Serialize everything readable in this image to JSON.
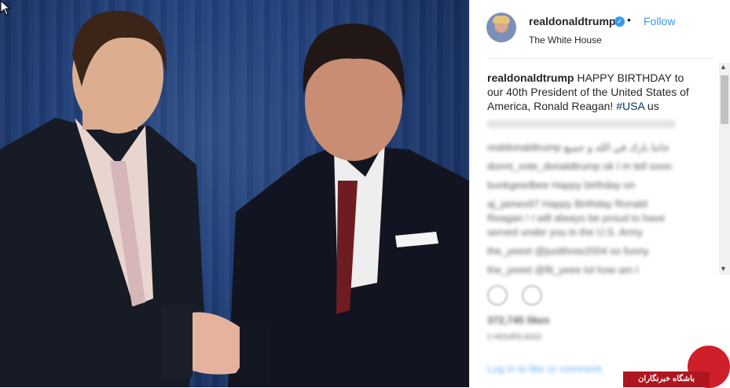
{
  "post": {
    "username": "realdonaldtrump",
    "follow_label": "Follow",
    "separator": "•",
    "location": "The White House",
    "caption_text": "HAPPY BIRTHDAY to our 40th President of the United States of America, Ronald Reagan!",
    "hashtag": "#USA",
    "caption_tail": "us"
  },
  "blurred_comments": [
    "realdonaldtrump خاتنا بارك في الله و جميع",
    "donnt_vote_donaldtrump ok I m tell soon",
    "bunkgeedbee Happy birthday on",
    "aj_james97 Happy Birthday Ronald",
    "Reagan ! I will always be proud to have",
    "served under you in the U.S. Army",
    "the_yeeet @justthree2004 so funny",
    "the_yeeet @fit_yeee lol how am I"
  ],
  "blurred_stats": {
    "likes": "372,745 likes",
    "time": "2 HOURS AGO",
    "login": "Log in to like or comment."
  },
  "watermark": {
    "text": "باشگاه خبرنگاران"
  },
  "icons": [
    "heart-icon",
    "comment-icon",
    "verified-icon",
    "mouse-cursor-icon"
  ],
  "colors": {
    "link_blue": "#3897f0",
    "logo_red": "#cf1f2a"
  }
}
